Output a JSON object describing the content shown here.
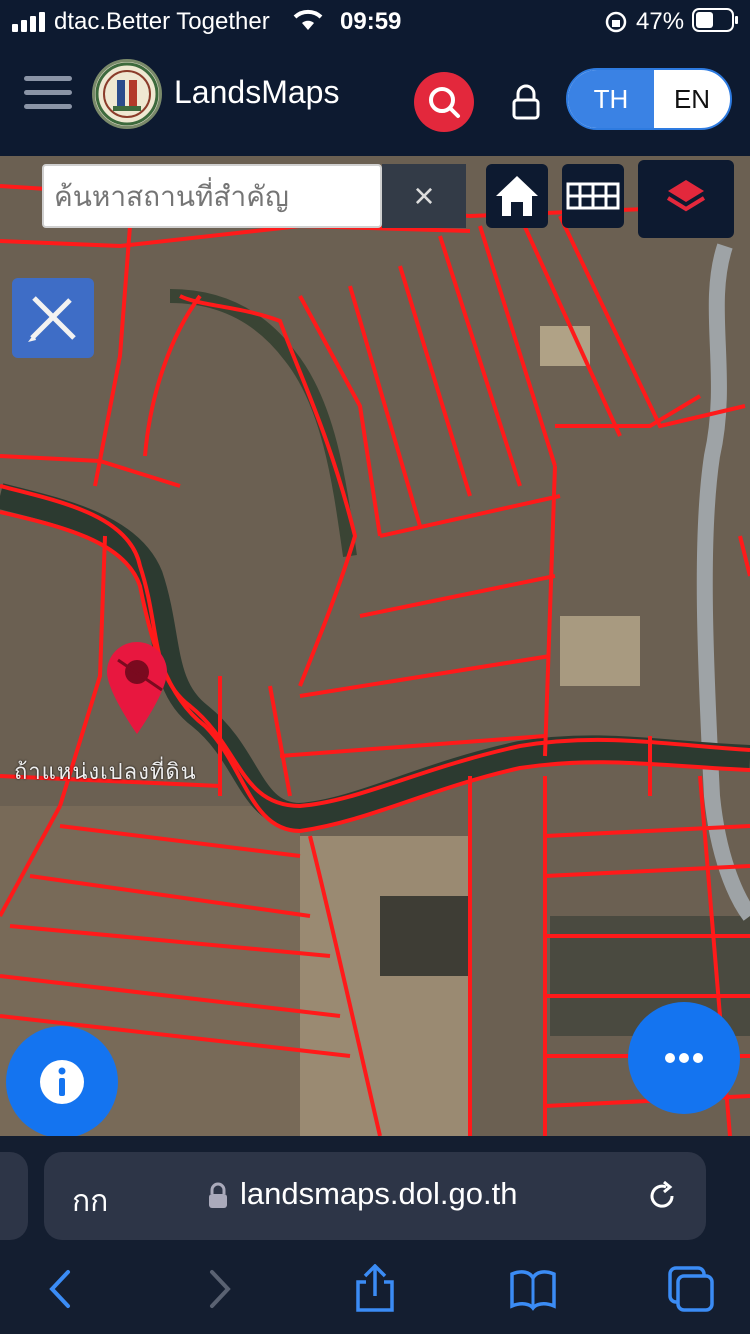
{
  "status_bar": {
    "carrier": "dtac.Better Together",
    "time": "09:59",
    "battery": "47%"
  },
  "header": {
    "app_name": "LandsMaps",
    "lang_th": "TH",
    "lang_en": "EN",
    "active_lang": "TH"
  },
  "map": {
    "search_placeholder": "ค้นหาสถานที่สำคัญ",
    "clear_symbol": "×",
    "road_label": "ถ้าแหน่งเปลงที่ดิน"
  },
  "browser": {
    "text_size_label": "กก",
    "url": "landsmaps.dol.go.th"
  },
  "colors": {
    "header_bg": "#0d1a30",
    "accent_blue": "#1474f0",
    "search_red": "#e3283c",
    "parcel_line": "#ff1a1a",
    "marker": "#e8173f"
  }
}
